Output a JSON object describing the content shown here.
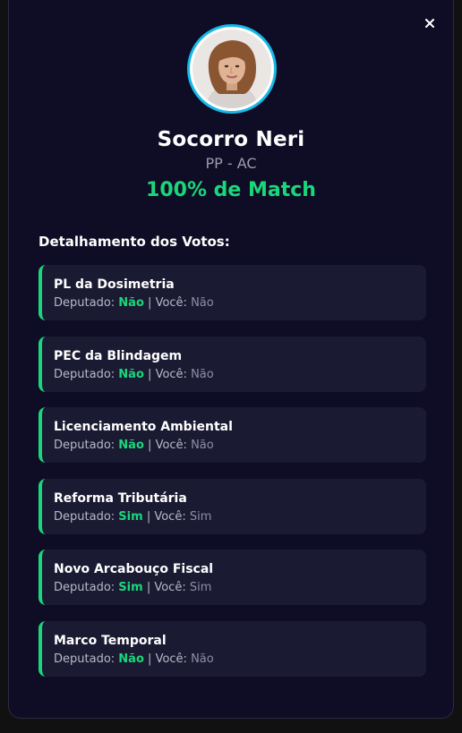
{
  "profile": {
    "name": "Socorro Neri",
    "party": "PP - AC",
    "match": "100% de Match"
  },
  "section_title": "Detalhamento dos Votos:",
  "votes": [
    {
      "title": "PL da Dosimetria",
      "deputy_label": "Deputado:",
      "deputy_vote": "Não",
      "separator": "|",
      "you_label": "Você:",
      "you_vote": "Não"
    },
    {
      "title": "PEC da Blindagem",
      "deputy_label": "Deputado:",
      "deputy_vote": "Não",
      "separator": "|",
      "you_label": "Você:",
      "you_vote": "Não"
    },
    {
      "title": "Licenciamento Ambiental",
      "deputy_label": "Deputado:",
      "deputy_vote": "Não",
      "separator": "|",
      "you_label": "Você:",
      "you_vote": "Não"
    },
    {
      "title": "Reforma Tributária",
      "deputy_label": "Deputado:",
      "deputy_vote": "Sim",
      "separator": "|",
      "you_label": "Você:",
      "you_vote": "Sim"
    },
    {
      "title": "Novo Arcabouço Fiscal",
      "deputy_label": "Deputado:",
      "deputy_vote": "Sim",
      "separator": "|",
      "you_label": "Você:",
      "you_vote": "Sim"
    },
    {
      "title": "Marco Temporal",
      "deputy_label": "Deputado:",
      "deputy_vote": "Não",
      "separator": "|",
      "you_label": "Você:",
      "you_vote": "Não"
    }
  ],
  "icons": {
    "close": "close-icon"
  },
  "colors": {
    "background": "#0e0d25",
    "card": "#1b1a33",
    "accent_green": "#19d77a",
    "avatar_ring": "#16b9e8"
  }
}
